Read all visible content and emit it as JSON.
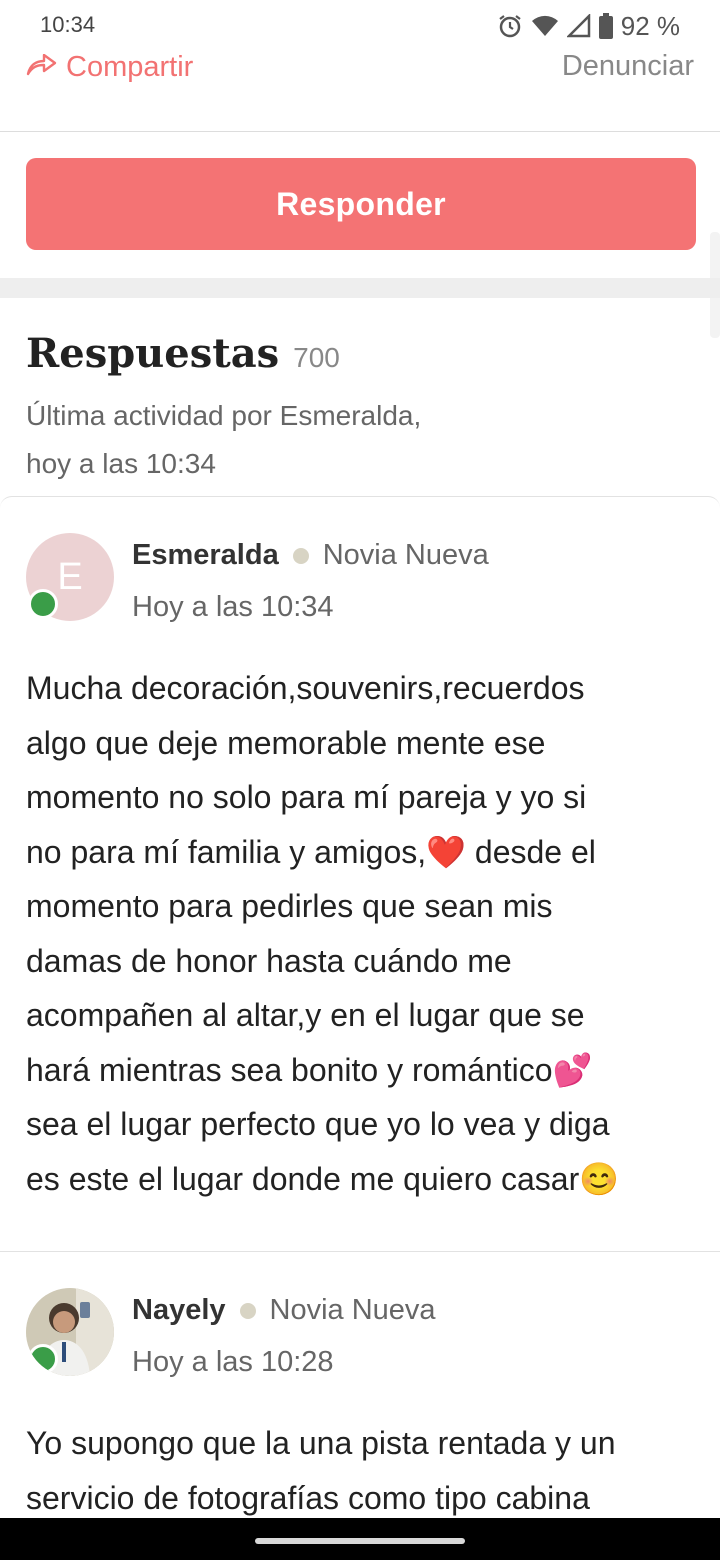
{
  "status_bar": {
    "time": "10:34",
    "battery_percent": "92 %",
    "icons": [
      "alarm-icon",
      "wifi-icon",
      "signal-icon",
      "battery-icon"
    ]
  },
  "actions": {
    "share_label": "Compartir",
    "report_label": "Denunciar"
  },
  "reply_button_label": "Responder",
  "replies": {
    "title": "Respuestas",
    "count": "700",
    "last_activity_line1": "Última actividad por Esmeralda,",
    "last_activity_line2": "hoy a las 10:34"
  },
  "posts": [
    {
      "avatar_initial": "E",
      "author": "Esmeralda",
      "rank": "Novia Nueva",
      "time": "Hoy a las 10:34",
      "online": true,
      "body": "Mucha decoración,souvenirs,recuerdos\nalgo que deje memorable mente ese\nmomento no solo para mí pareja y yo si\nno para mí familia y amigos,❤️ desde el\nmomento para pedirles que sean mis\ndamas de honor hasta cuándo me\nacompañen al altar,y en el lugar que se\nhará mientras sea bonito y romántico💕\nsea el lugar perfecto que yo lo vea y diga\nes este el lugar donde me quiero casar😊"
    },
    {
      "author": "Nayely",
      "rank": "Novia Nueva",
      "time": "Hoy a las 10:28",
      "online": true,
      "body": "Yo supongo que la una pista rentada y un\nservicio de fotografías como tipo cabina"
    }
  ],
  "colors": {
    "accent": "#f47374",
    "online": "#3a9d48",
    "avatar_bg": "#ecd2d3"
  }
}
